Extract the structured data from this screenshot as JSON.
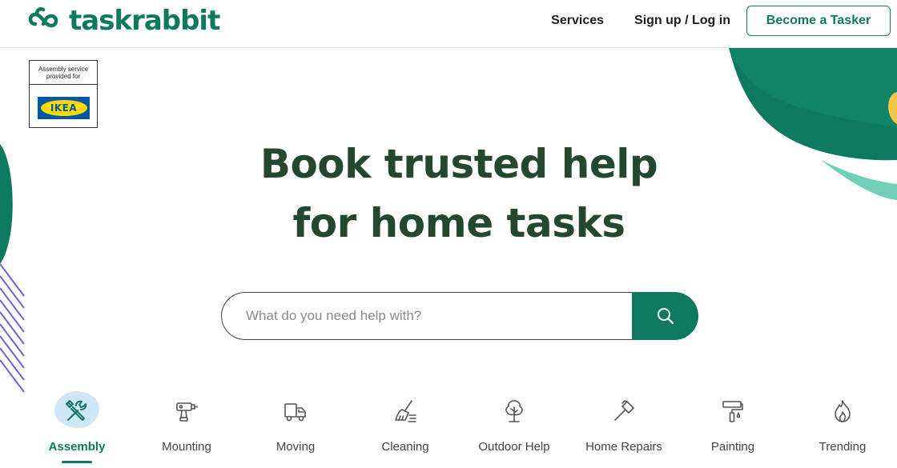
{
  "header": {
    "logo_text": "taskrabbit",
    "nav": {
      "services": "Services",
      "login": "Sign up / Log in",
      "become_tasker": "Become a Tasker"
    }
  },
  "ikea_badge": {
    "caption": "Assembly service provided for",
    "brand": "IKEA"
  },
  "hero": {
    "title_line1": "Book trusted help",
    "title_line2": "for home tasks"
  },
  "search": {
    "placeholder": "What do you need help with?",
    "value": "",
    "button_icon": "search-icon"
  },
  "categories": [
    {
      "label": "Assembly",
      "icon": "tools-icon",
      "active": true
    },
    {
      "label": "Mounting",
      "icon": "drill-icon",
      "active": false
    },
    {
      "label": "Moving",
      "icon": "truck-icon",
      "active": false
    },
    {
      "label": "Cleaning",
      "icon": "broom-icon",
      "active": false
    },
    {
      "label": "Outdoor Help",
      "icon": "tree-icon",
      "active": false
    },
    {
      "label": "Home Repairs",
      "icon": "hammer-icon",
      "active": false
    },
    {
      "label": "Painting",
      "icon": "paint-roller-icon",
      "active": false
    },
    {
      "label": "Trending",
      "icon": "flame-icon",
      "active": false
    }
  ],
  "colors": {
    "brand_green": "#0d7a5f",
    "hero_text": "#24482e",
    "accent_mint": "#6fd0b7",
    "accent_yellow": "#f4c74a",
    "accent_purple": "#6b63d6",
    "assembly_highlight": "#cfe6f6"
  }
}
